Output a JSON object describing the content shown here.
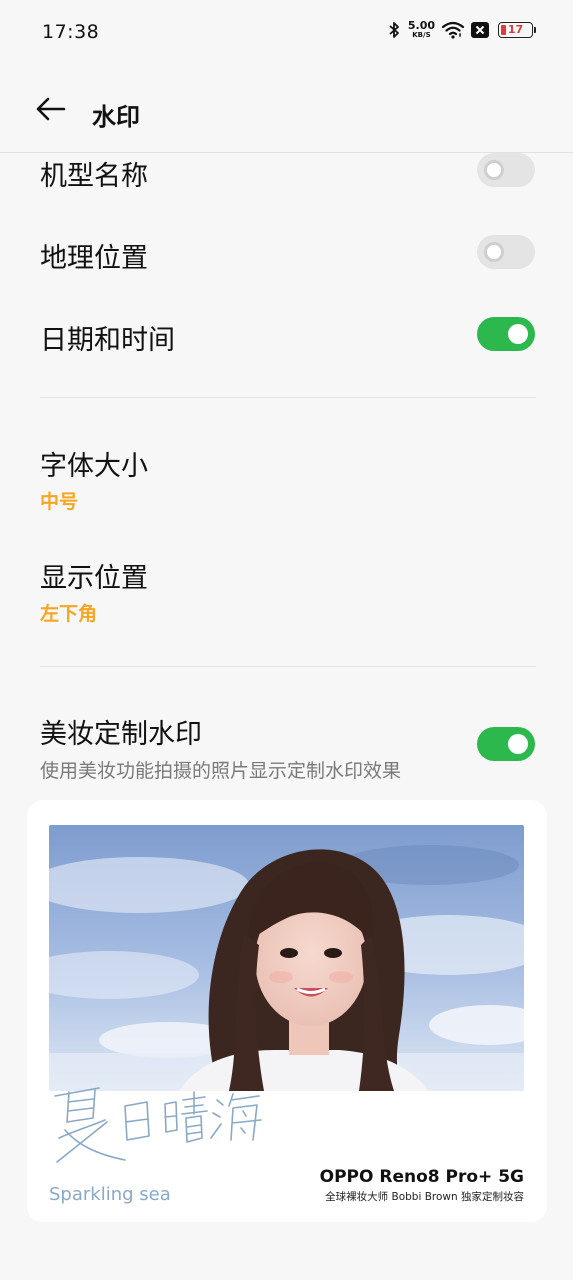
{
  "status_bar": {
    "time": "17:38",
    "net_speed_value": "5.00",
    "net_speed_unit": "KB/S",
    "battery_level": "17",
    "icons": [
      "bluetooth-icon",
      "wifi-icon",
      "close-box-icon",
      "battery-icon"
    ]
  },
  "header": {
    "title": "水印",
    "back_icon": "arrow-left-icon"
  },
  "settings": {
    "model_name": {
      "label": "机型名称",
      "enabled": false
    },
    "location": {
      "label": "地理位置",
      "enabled": false
    },
    "datetime": {
      "label": "日期和时间",
      "enabled": true
    },
    "font_size": {
      "label": "字体大小",
      "value": "中号"
    },
    "position": {
      "label": "显示位置",
      "value": "左下角"
    },
    "beauty_watermark": {
      "label": "美妆定制水印",
      "description": "使用美妆功能拍摄的照片显示定制水印效果",
      "enabled": true
    }
  },
  "preview": {
    "handwriting_text": "夏日晴海",
    "caption": "Sparkling sea",
    "brand": "OPPO Reno8 Pro+ 5G",
    "brand_sub": "全球裸妆大师 Bobbi Brown 独家定制妆容"
  },
  "colors": {
    "accent": "#f5a623",
    "toggle_on": "#2db84d",
    "toggle_off": "#e4e4e4",
    "background": "#f7f7f7"
  }
}
